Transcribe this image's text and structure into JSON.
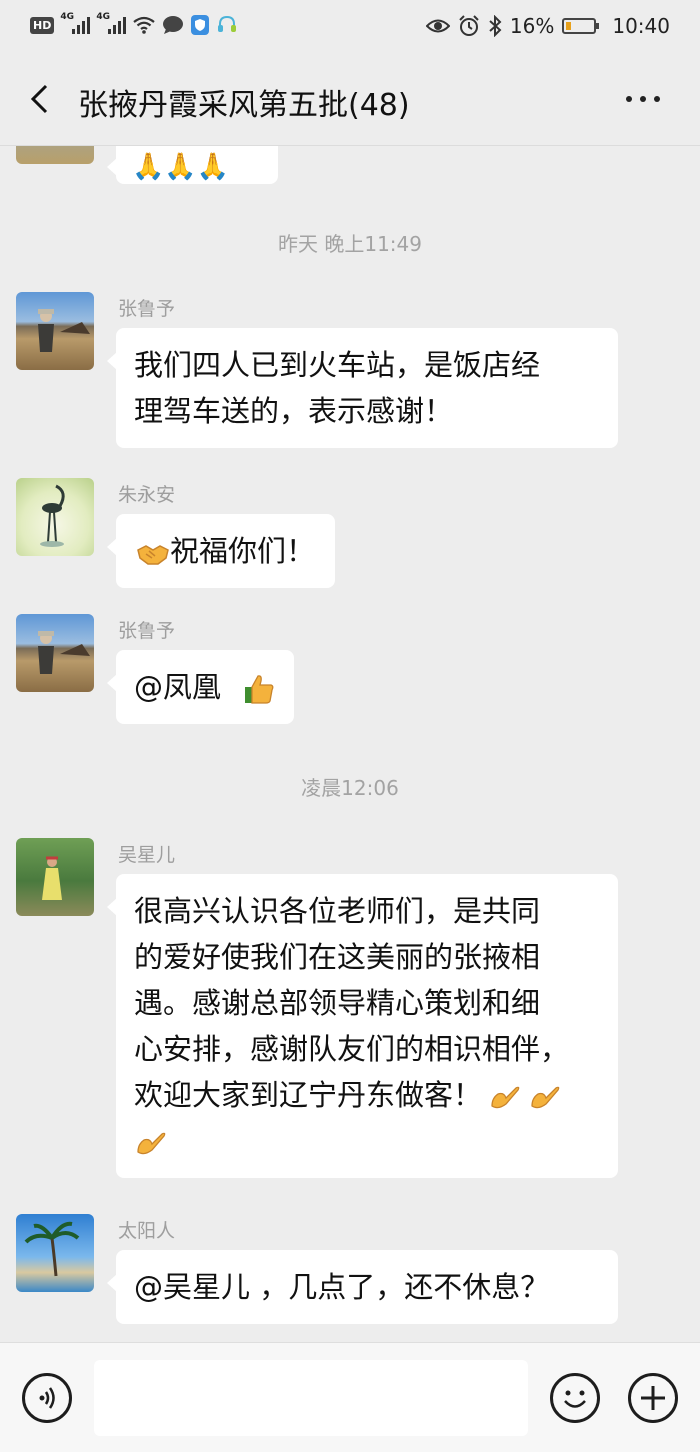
{
  "status_bar": {
    "hd": "HD",
    "net1": "4G",
    "net2": "4G",
    "battery_pct": "16%",
    "battery_level": 0.16,
    "time": "10:40"
  },
  "header": {
    "title": "张掖丹霞采风第五批(48)"
  },
  "chat": {
    "timestamps": [
      "昨天 晚上11:49",
      "凌晨12:06"
    ],
    "messages": [
      {
        "sender": "张鲁予",
        "text_lines": [
          "我们四人已到火车站，是饭店经",
          "理驾车送的，表示感谢！"
        ]
      },
      {
        "sender": "朱永安",
        "text": "祝福你们！",
        "emoji": "handshake-emoji"
      },
      {
        "sender": "张鲁予",
        "text": "@凤凰",
        "emoji": "thumbs-up-emoji"
      },
      {
        "sender": "吴星儿",
        "text_lines": [
          "很高兴认识各位老师们，是共同",
          "的爱好使我们在这美丽的张掖相",
          "遇。感谢总部领导精心策划和细",
          "心安排，感谢队友们的相识相伴，",
          "欢迎大家到辽宁丹东做客！"
        ],
        "emoji": "ok-hand-emoji"
      },
      {
        "sender": "太阳人",
        "text": "@吴星儿 ，几点了，还不休息？"
      }
    ]
  },
  "colors": {
    "background": "#ededed",
    "bubble": "#ffffff",
    "meta_text": "#9e9e9e"
  }
}
